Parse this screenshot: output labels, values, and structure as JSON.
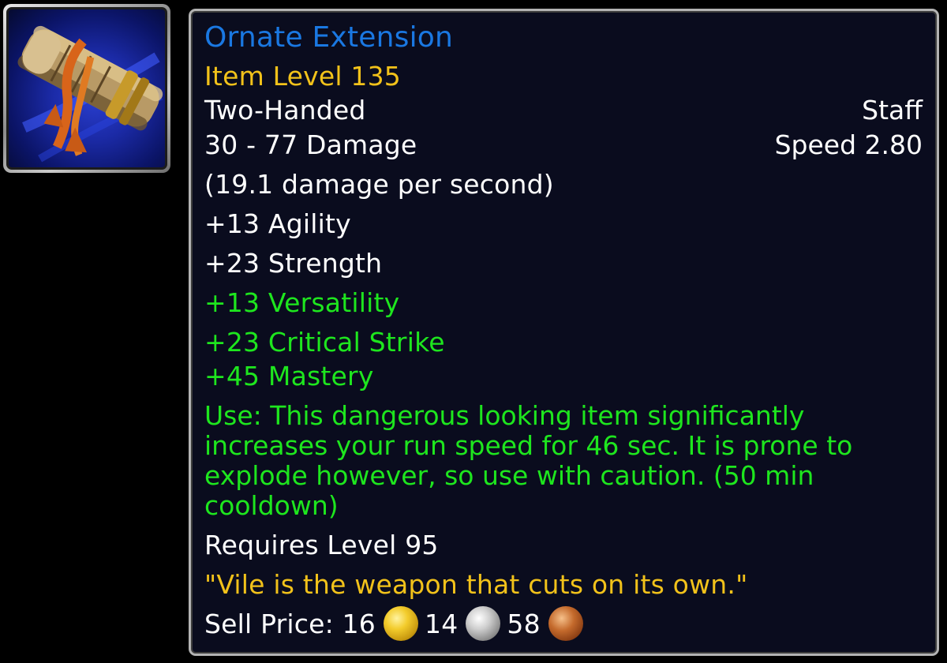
{
  "item": {
    "name": "Ornate Extension",
    "item_level": "Item Level 135",
    "hand_type": "Two-Handed",
    "weapon_type": "Staff",
    "damage": "30 - 77 Damage",
    "speed": "Speed 2.80",
    "dps": "(19.1 damage per second)",
    "stats": {
      "agility": "+13 Agility",
      "strength": "+23 Strength"
    },
    "secondary_stats": {
      "versatility": "+13 Versatility",
      "critical_strike": "+23 Critical Strike",
      "mastery": "+45 Mastery"
    },
    "use_effect": "Use: This dangerous looking item significantly increases your run speed for 46 sec. It is prone to explode however, so use with caution. (50 min cooldown)",
    "requires_level": "Requires Level 95",
    "flavor_text": "\"Vile is the weapon that cuts on its own.\"",
    "sell_price": {
      "label": "Sell Price:",
      "gold": "16",
      "silver": "14",
      "copper": "58"
    },
    "icon": "rocket-staff-icon"
  },
  "colors": {
    "name": "#1a78e2",
    "item_level": "#f2c21a",
    "secondary_stat": "#1ee61e",
    "flavor": "#f2c21a",
    "text": "#ffffff",
    "background": "#0a0c1e",
    "border": "#b3b3b3"
  }
}
